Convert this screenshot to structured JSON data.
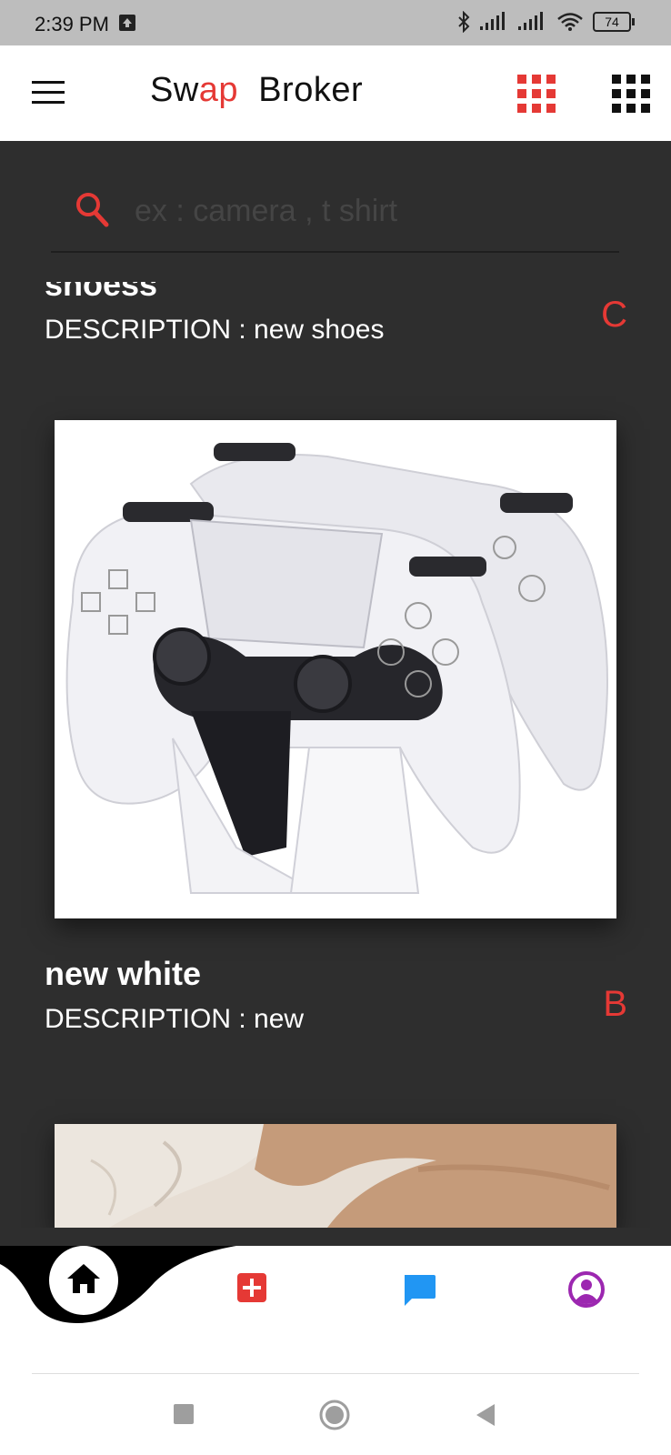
{
  "status_bar": {
    "time": "2:39 PM",
    "battery": "74",
    "icons": [
      "upload-icon",
      "bluetooth-icon",
      "signal-icon",
      "signal-icon",
      "wifi-icon",
      "battery-icon"
    ]
  },
  "header": {
    "title_part1": "Sw",
    "title_accent": "ap",
    "title_part2": "Broker",
    "icons": [
      "menu-icon",
      "grid-view-icon",
      "grid-compact-icon"
    ],
    "colors": {
      "accent": "#e53935",
      "dark": "#111111"
    }
  },
  "search": {
    "placeholder": "ex : camera , t shirt",
    "value": ""
  },
  "feed": {
    "items": [
      {
        "title": "shoess",
        "description": "DESCRIPTION : new shoes",
        "grade": "C"
      },
      {
        "title": "new white",
        "description": "DESCRIPTION : new",
        "grade": "B",
        "image": "game-controllers-photo"
      },
      {
        "image": "fabric-photo"
      }
    ]
  },
  "bottom_nav": {
    "items": [
      "home-icon",
      "add-icon",
      "chat-icon",
      "profile-icon"
    ],
    "colors": {
      "add": "#e53935",
      "chat": "#2196f3",
      "profile": "#9c27b0"
    }
  },
  "system_nav": [
    "recents-button",
    "home-button",
    "back-button"
  ]
}
